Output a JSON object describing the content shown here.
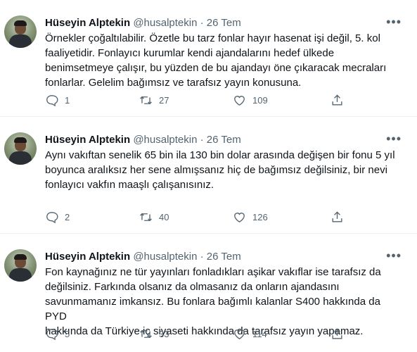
{
  "tweets": [
    {
      "author": "Hüseyin Alptekin",
      "handle": "@husalptekin",
      "separator": "·",
      "date": "26 Tem",
      "text_lines": [
        "Örnekler çoğaltılabilir. Özetle bu tarz fonlar hayır hasenat işi değil, 5. kol",
        "faaliyetidir. Fonlayıcı kurumlar kendi ajandalarını hedef ülkede",
        "benimsetmeye çalışır, bu yüzden de bu ajandayı öne çıkaracak mecraları",
        "fonlarlar. Gelelim bağımsız ve tarafsız yayın konusuna."
      ],
      "replies": "1",
      "retweets": "27",
      "likes": "109"
    },
    {
      "author": "Hüseyin Alptekin",
      "handle": "@husalptekin",
      "separator": "·",
      "date": "26 Tem",
      "text_lines": [
        "Aynı vakıftan senelik 65 bin ila 130 bin dolar arasında değişen bir fonu 5 yıl",
        "boyunca aralıksız her sene almışsanız hiç de bağımsız değilsiniz, bir nevi",
        "fonlayıcı vakfın maaşlı çalışanısınız."
      ],
      "replies": "2",
      "retweets": "40",
      "likes": "126"
    },
    {
      "author": "Hüseyin Alptekin",
      "handle": "@husalptekin",
      "separator": "·",
      "date": "26 Tem",
      "text_lines": [
        "Fon kaynağınız ne tür yayınları fonladıkları aşikar vakıflar ise tarafsız da",
        "değilsiniz. Farkında olsanız da olmasanız da onların ajandasını",
        "savunmamanız imkansız. Bu fonlara bağımlı kalanlar S400 hakkında da PYD",
        "hakkında da Türkiye iç siyaseti hakkında da tarafsız yayın yapamaz."
      ],
      "replies": "5",
      "retweets": "33",
      "likes": "114"
    }
  ],
  "icons": {
    "avatar": "avatar",
    "more": "more-options-icon",
    "reply": "reply-icon",
    "retweet": "retweet-icon",
    "like": "like-icon",
    "share": "share-icon"
  },
  "colors": {
    "text": "#0f1419",
    "secondary": "#536471",
    "divider": "#eff3f4"
  }
}
